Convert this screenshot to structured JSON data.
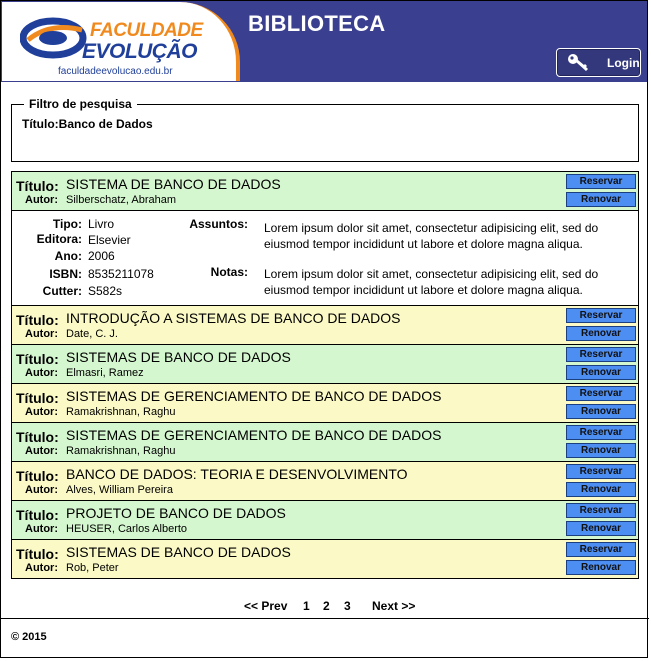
{
  "header": {
    "logo_line1": "FACULDADE",
    "logo_line2": "EVOLUÇÃO",
    "logo_url": "faculdadeevolucao.edu.br",
    "title": "BIBLIOTECA",
    "login_label": "Login",
    "colors": {
      "bar": "#3b3f8f",
      "accent": "#f08a1e",
      "brand_blue": "#1f3f9a"
    }
  },
  "filter": {
    "legend": "Filtro de pesquisa",
    "text": "Título:Banco de Dados"
  },
  "labels": {
    "title": "Título:",
    "author": "Autor:",
    "reserve": "Reservar",
    "renew": "Renovar",
    "tipo": "Tipo:",
    "editora": "Editora:",
    "ano": "Ano:",
    "isbn": "ISBN:",
    "cutter": "Cutter:",
    "assuntos": "Assuntos:",
    "notas": "Notas:"
  },
  "books": [
    {
      "title": "SISTEMA DE BANCO DE DADOS",
      "author": "Silberschatz, Abraham",
      "color": "green"
    },
    {
      "title": "INTRODUÇÃO A SISTEMAS DE BANCO DE DADOS",
      "author": "Date, C. J.",
      "color": "yellow"
    },
    {
      "title": "SISTEMAS DE BANCO DE DADOS",
      "author": "Elmasri, Ramez",
      "color": "green"
    },
    {
      "title": "SISTEMAS DE GERENCIAMENTO DE BANCO DE DADOS",
      "author": "Ramakrishnan, Raghu",
      "color": "yellow"
    },
    {
      "title": "SISTEMAS DE GERENCIAMENTO DE BANCO DE DADOS",
      "author": "Ramakrishnan, Raghu",
      "color": "green"
    },
    {
      "title": "BANCO DE DADOS: TEORIA E DESENVOLVIMENTO",
      "author": "Alves, William Pereira",
      "color": "yellow"
    },
    {
      "title": "PROJETO DE BANCO DE DADOS",
      "author": "HEUSER, Carlos Alberto",
      "color": "green"
    },
    {
      "title": "SISTEMAS DE BANCO DE DADOS",
      "author": "Rob, Peter",
      "color": "yellow"
    }
  ],
  "detail": {
    "tipo": "Livro",
    "editora": "Elsevier",
    "ano": "2006",
    "isbn": "8535211078",
    "cutter": "S582s",
    "assuntos": "Lorem ipsum dolor sit amet, consectetur adipisicing elit, sed do eiusmod tempor incididunt ut labore et dolore magna aliqua.",
    "notas": "Lorem ipsum dolor sit amet, consectetur adipisicing elit, sed do eiusmod tempor incididunt ut labore et dolore magna aliqua."
  },
  "pagination": {
    "prev": "<< Prev",
    "pages": [
      "1",
      "2",
      "3"
    ],
    "next": "Next >>"
  },
  "footer": {
    "copyright": "© 2015"
  },
  "row_colors": {
    "green": "#d5f7cf",
    "yellow": "#fbfac6",
    "button": "#4d8ef2"
  }
}
